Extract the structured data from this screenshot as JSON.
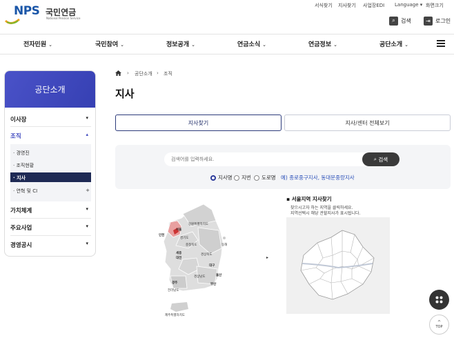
{
  "header": {
    "logo_text": "NPS",
    "logo_korean": "국민연금",
    "logo_english": "National Pension Service",
    "util_links": [
      "서식찾기",
      "지사찾기",
      "사업장EDI",
      "Language",
      "화면크기"
    ],
    "search_label": "검색",
    "login_label": "로그인"
  },
  "gnb": {
    "items": [
      "전자민원",
      "국민참여",
      "정보공개",
      "연금소식",
      "연금정보",
      "공단소개"
    ],
    "caret": "⌄"
  },
  "sidebar": {
    "title": "공단소개",
    "items": [
      "이사장",
      "조직",
      "가치체계",
      "주요사업",
      "경영공시"
    ],
    "sub_items": [
      "경영진",
      "조직현황",
      "지사",
      "연혁 및 CI"
    ],
    "caret_down": "▾",
    "caret_up": "▴",
    "plus": "+"
  },
  "breadcrumb": {
    "items": [
      "공단소개",
      "조직"
    ]
  },
  "page_title": "지사",
  "tabs": [
    "지사찾기",
    "지사/센터 전체보기"
  ],
  "search": {
    "placeholder": "검색어를 입력하세요.",
    "button_label": "검색",
    "radios": [
      "지사명",
      "지번",
      "도로명"
    ],
    "example": "예) 종로중구지사, 동대문중랑지사"
  },
  "map": {
    "title": "서울지역 지사찾기",
    "desc_line1": "찾으시고자 하는 지역을 클릭하세요.",
    "desc_line2": "지역선택시 해당 관할지사가 표시됩니다.",
    "korea_labels": [
      "서울",
      "인천",
      "경기도",
      "강원특별자치도",
      "충청북도",
      "세종",
      "대전",
      "경상북도",
      "대구",
      "울산",
      "부산",
      "광주",
      "전라남도",
      "경상남도",
      "제주특별자치도",
      "동해"
    ]
  },
  "fab": {
    "top_label": "TOP"
  },
  "colors": {
    "accent": "#3a44bd",
    "active_sub": "#1e2a55",
    "link": "#2a4fb8"
  }
}
